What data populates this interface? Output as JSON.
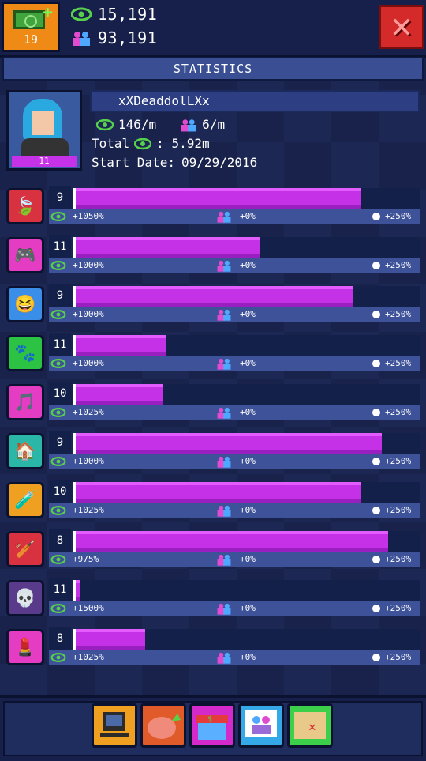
{
  "topbar": {
    "cash_level": "19",
    "views": "15,191",
    "subscribers": "93,191"
  },
  "title": "STATISTICS",
  "profile": {
    "name": "xXDeaddolLXx",
    "views_per_min": "146/m",
    "subs_per_min": "6/m",
    "total_label": "Total",
    "total_value": ": 5.92m",
    "start_date_label": "Start Date:",
    "start_date": "09/29/2016",
    "level": "11"
  },
  "categories": [
    {
      "name": "leaf",
      "level": "9",
      "fill": 0.83,
      "views": "+1050%",
      "subs": "+0%",
      "time": "+250%",
      "color": "#d8313f",
      "icon": "🍃"
    },
    {
      "name": "gamepad",
      "level": "11",
      "fill": 0.54,
      "views": "+1000%",
      "subs": "+0%",
      "time": "+250%",
      "color": "#e43cc2",
      "icon": "🎮"
    },
    {
      "name": "laugh",
      "level": "9",
      "fill": 0.81,
      "views": "+1000%",
      "subs": "+0%",
      "time": "+250%",
      "color": "#3a8ee8",
      "icon": "😆"
    },
    {
      "name": "paw",
      "level": "11",
      "fill": 0.27,
      "views": "+1000%",
      "subs": "+0%",
      "time": "+250%",
      "color": "#2cc244",
      "icon": "🐾"
    },
    {
      "name": "music",
      "level": "10",
      "fill": 0.26,
      "views": "+1025%",
      "subs": "+0%",
      "time": "+250%",
      "color": "#e43cc2",
      "icon": "🎵"
    },
    {
      "name": "shop",
      "level": "9",
      "fill": 0.89,
      "views": "+1000%",
      "subs": "+0%",
      "time": "+250%",
      "color": "#2ab7a8",
      "icon": "🏠"
    },
    {
      "name": "science",
      "level": "10",
      "fill": 0.83,
      "views": "+1025%",
      "subs": "+0%",
      "time": "+250%",
      "color": "#f0a020",
      "icon": "🧪"
    },
    {
      "name": "sports",
      "level": "8",
      "fill": 0.91,
      "views": "+975%",
      "subs": "+0%",
      "time": "+250%",
      "color": "#d8313f",
      "icon": "🏏"
    },
    {
      "name": "horror",
      "level": "11",
      "fill": 0.02,
      "views": "+1500%",
      "subs": "+0%",
      "time": "+250%",
      "color": "#5a3a8a",
      "icon": "💀"
    },
    {
      "name": "beauty",
      "level": "8",
      "fill": 0.21,
      "views": "+1025%",
      "subs": "+0%",
      "time": "+250%",
      "color": "#e43cc2",
      "icon": "💄"
    }
  ],
  "bottom_tabs": [
    "computer",
    "brain-upgrade",
    "shop",
    "social",
    "map"
  ]
}
